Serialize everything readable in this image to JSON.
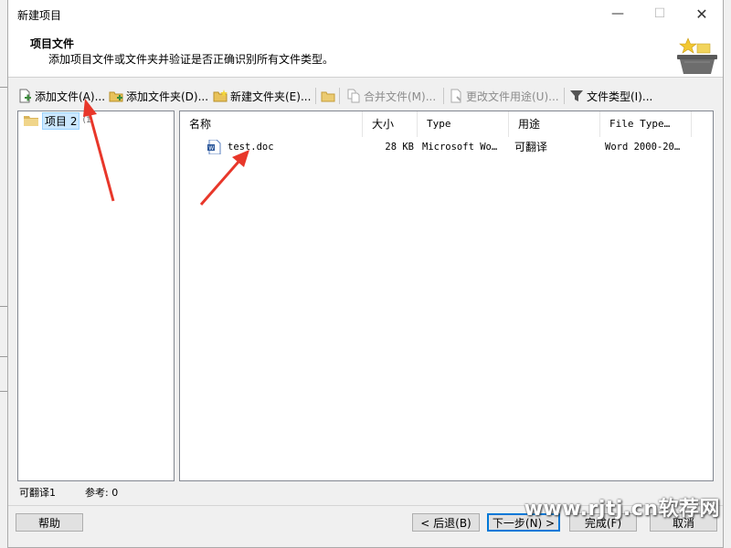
{
  "window": {
    "title": "新建项目",
    "minimize": "—",
    "maximize": "☐",
    "close": "✕"
  },
  "header": {
    "title": "项目文件",
    "description": "添加项目文件或文件夹并验证是否正确识别所有文件类型。"
  },
  "toolbar": {
    "add_files": "添加文件(A)...",
    "add_folder": "添加文件夹(D)...",
    "new_folder": "新建文件夹(E)...",
    "merge_files": "合并文件(M)...",
    "change_usage": "更改文件用途(U)...",
    "file_types": "文件类型(I)..."
  },
  "tree": {
    "item_label": "项目 2",
    "item_count": "(1"
  },
  "files": {
    "columns": [
      "名称",
      "大小",
      "Type",
      "用途",
      "File Type…"
    ],
    "rows": [
      {
        "name": "test.doc",
        "size": "28 KB",
        "type": "Microsoft Wo…",
        "usage": "可翻译",
        "file_type": "Word 2000-20…"
      }
    ]
  },
  "status": {
    "translatable": "可翻译1",
    "reference": "参考: 0"
  },
  "buttons": {
    "help": "帮助",
    "back": "< 后退(B)",
    "next": "下一步(N) >",
    "finish": "完成(F)",
    "cancel": "取消"
  },
  "watermark": "www.rjtj.cn软荐网",
  "colors": {
    "selection": "#cce8ff",
    "arrow": "#e8372a",
    "accent": "#0078d7"
  }
}
